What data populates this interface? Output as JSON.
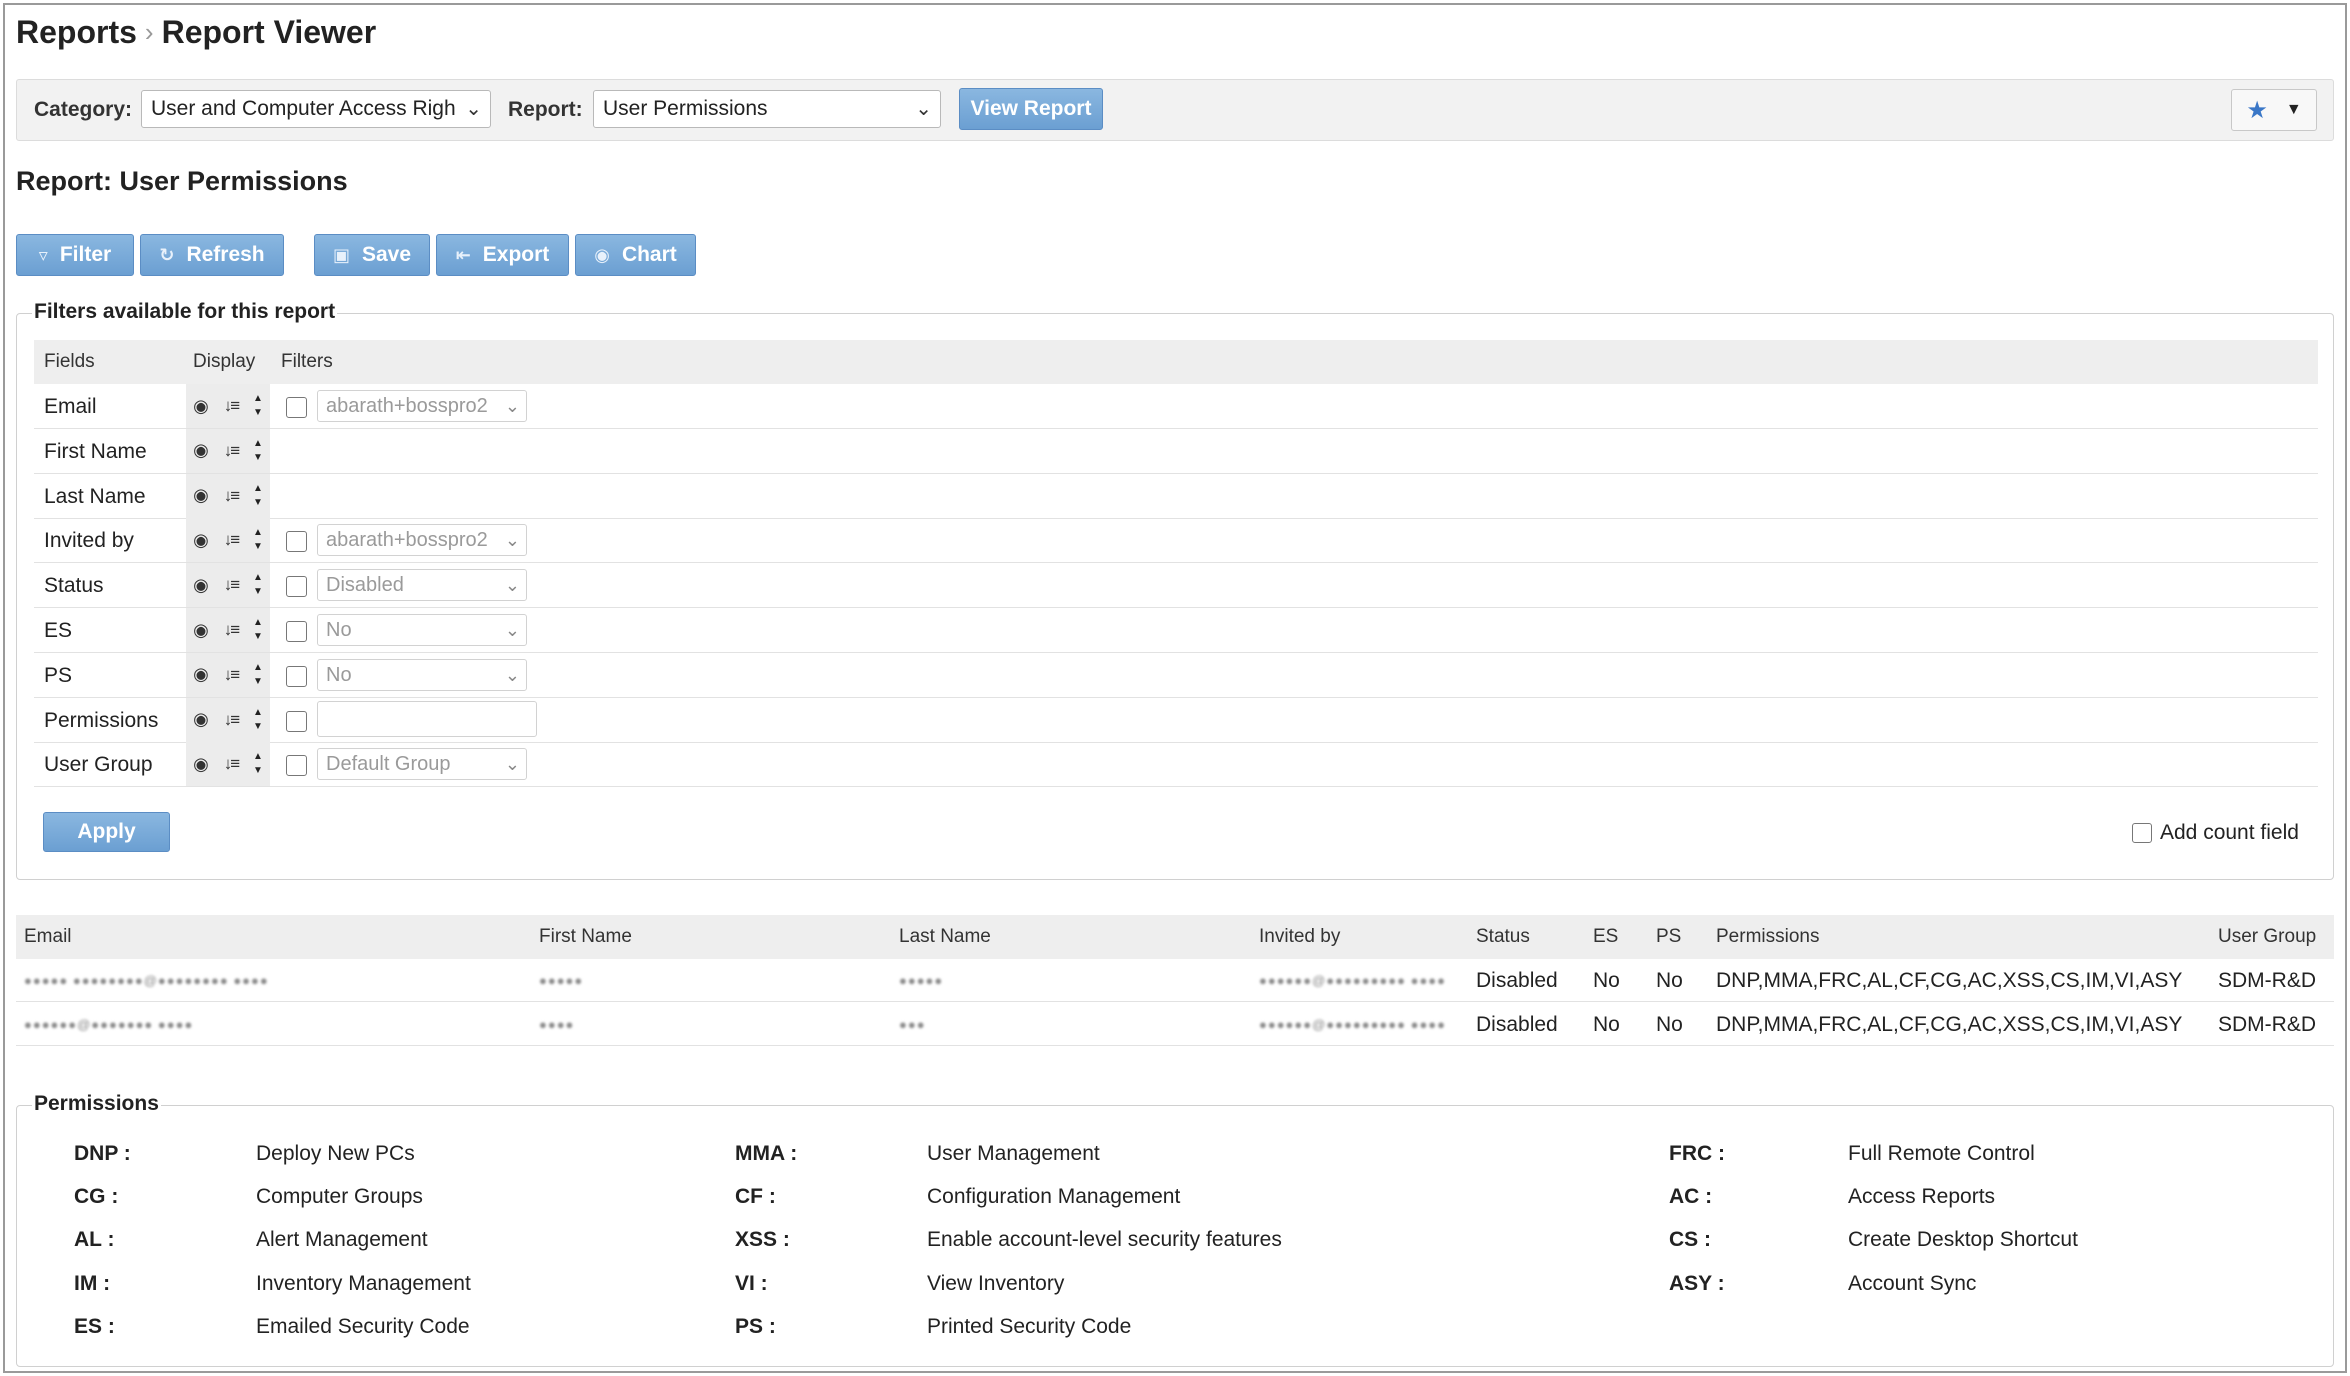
{
  "breadcrumb": {
    "root": "Reports",
    "separator": "›",
    "current": "Report Viewer"
  },
  "selector_bar": {
    "category_label": "Category:",
    "category_value": "User and Computer Access Righ",
    "report_label": "Report:",
    "report_value": "User Permissions",
    "view_button": "View Report"
  },
  "report_title": "Report: User Permissions",
  "toolbar": {
    "filter": "Filter",
    "refresh": "Refresh",
    "save": "Save",
    "export": "Export",
    "chart": "Chart"
  },
  "filters": {
    "legend": "Filters available for this report",
    "headers": {
      "fields": "Fields",
      "display": "Display",
      "filters": "Filters"
    },
    "rows": [
      {
        "field": "Email",
        "filter_type": "select",
        "filter_value": "abarath+bosspro2"
      },
      {
        "field": "First Name",
        "filter_type": "none",
        "filter_value": ""
      },
      {
        "field": "Last Name",
        "filter_type": "none",
        "filter_value": ""
      },
      {
        "field": "Invited by",
        "filter_type": "select",
        "filter_value": "abarath+bosspro2"
      },
      {
        "field": "Status",
        "filter_type": "select",
        "filter_value": "Disabled"
      },
      {
        "field": "ES",
        "filter_type": "select",
        "filter_value": "No"
      },
      {
        "field": "PS",
        "filter_type": "select",
        "filter_value": "No"
      },
      {
        "field": "Permissions",
        "filter_type": "text",
        "filter_value": ""
      },
      {
        "field": "User Group",
        "filter_type": "select",
        "filter_value": "Default Group"
      }
    ],
    "apply_button": "Apply",
    "add_count_label": "Add count field"
  },
  "results": {
    "headers": {
      "email": "Email",
      "first_name": "First Name",
      "last_name": "Last Name",
      "invited_by": "Invited by",
      "status": "Status",
      "es": "ES",
      "ps": "PS",
      "permissions": "Permissions",
      "user_group": "User Group"
    },
    "rows": [
      {
        "email": "●●●●● ●●●●●●●●@●●●●●●●● ●●●●",
        "first_name": "●●●●●",
        "last_name": "●●●●●",
        "invited_by": "●●●●●●@●●●●●●●●● ●●●●",
        "status": "Disabled",
        "es": "No",
        "ps": "No",
        "permissions": "DNP,MMA,FRC,AL,CF,CG,AC,XSS,CS,IM,VI,ASY",
        "user_group": "SDM-R&D"
      },
      {
        "email": "●●●●●●@●●●●●●● ●●●●",
        "first_name": "●●●●",
        "last_name": "●●●",
        "invited_by": "●●●●●●@●●●●●●●●● ●●●●",
        "status": "Disabled",
        "es": "No",
        "ps": "No",
        "permissions": "DNP,MMA,FRC,AL,CF,CG,AC,XSS,CS,IM,VI,ASY",
        "user_group": "SDM-R&D"
      }
    ]
  },
  "permissions_legend": {
    "legend": "Permissions",
    "items": [
      {
        "code": "DNP :",
        "desc": "Deploy New PCs"
      },
      {
        "code": "MMA :",
        "desc": "User Management"
      },
      {
        "code": "FRC :",
        "desc": "Full Remote Control"
      },
      {
        "code": "CG :",
        "desc": "Computer Groups"
      },
      {
        "code": "CF :",
        "desc": "Configuration Management"
      },
      {
        "code": "AC :",
        "desc": "Access Reports"
      },
      {
        "code": "AL :",
        "desc": "Alert Management"
      },
      {
        "code": "XSS :",
        "desc": "Enable account-level security features"
      },
      {
        "code": "CS :",
        "desc": "Create Desktop Shortcut"
      },
      {
        "code": "IM :",
        "desc": "Inventory Management"
      },
      {
        "code": "VI :",
        "desc": "View Inventory"
      },
      {
        "code": "ASY :",
        "desc": "Account Sync"
      },
      {
        "code": "ES :",
        "desc": "Emailed Security Code"
      },
      {
        "code": "PS :",
        "desc": "Printed Security Code"
      }
    ]
  },
  "colors": {
    "button_blue": "#6b9fd2",
    "star_blue": "#3a77c7",
    "header_gray": "#eeeeee"
  },
  "icons": {
    "filter": "filter-icon",
    "refresh": "refresh-icon",
    "save": "save-icon",
    "export": "export-icon",
    "chart": "chart-icon",
    "favorite": "star-icon",
    "display": "eye-icon",
    "sort": "sort-icon",
    "order": "up-down-arrow-icon"
  }
}
